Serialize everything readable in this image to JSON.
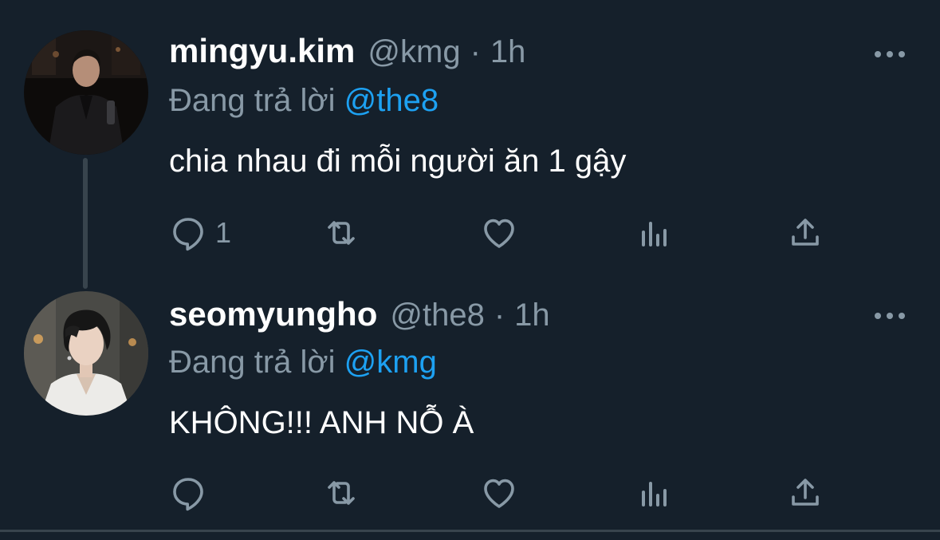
{
  "colors": {
    "background": "#15202b",
    "text_primary": "#ffffff",
    "text_secondary": "#8899a6",
    "link": "#1da1f2",
    "divider": "#38444d"
  },
  "tweets": [
    {
      "display_name": "mingyu.kim",
      "handle": "@kmg",
      "separator": "·",
      "time": "1h",
      "reply_prefix": "Đang trả lời",
      "reply_to": "@the8",
      "text": "chia nhau đi mỗi người ăn 1 gậy",
      "reply_count": "1",
      "icons": [
        "reply-icon",
        "retweet-icon",
        "like-icon",
        "stats-icon",
        "share-icon",
        "more-icon"
      ]
    },
    {
      "display_name": "seomyungho",
      "handle": "@the8",
      "separator": "·",
      "time": "1h",
      "reply_prefix": "Đang trả lời",
      "reply_to": "@kmg",
      "text": "KHÔNG!!! ANH NỖ À",
      "reply_count": "",
      "icons": [
        "reply-icon",
        "retweet-icon",
        "like-icon",
        "stats-icon",
        "share-icon",
        "more-icon"
      ]
    }
  ]
}
